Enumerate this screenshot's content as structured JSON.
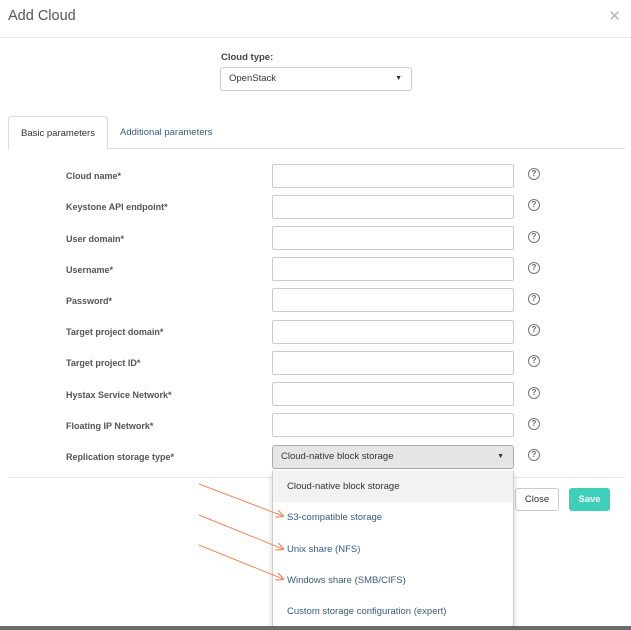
{
  "modal": {
    "title": "Add Cloud",
    "close_icon": "close-icon"
  },
  "cloud_type": {
    "label": "Cloud type:",
    "value": "OpenStack"
  },
  "tabs": [
    {
      "label": "Basic parameters",
      "active": true
    },
    {
      "label": "Additional parameters",
      "active": false
    }
  ],
  "fields": [
    {
      "label": "Cloud name*",
      "value": ""
    },
    {
      "label": "Keystone API endpoint*",
      "value": ""
    },
    {
      "label": "User domain*",
      "value": ""
    },
    {
      "label": "Username*",
      "value": ""
    },
    {
      "label": "Password*",
      "value": ""
    },
    {
      "label": "Target project domain*",
      "value": ""
    },
    {
      "label": "Target project ID*",
      "value": ""
    },
    {
      "label": "Hystax Service Network*",
      "value": ""
    },
    {
      "label": "Floating IP Network*",
      "value": ""
    }
  ],
  "replication": {
    "label": "Replication storage type*",
    "value": "Cloud-native block storage"
  },
  "dropdown_options": [
    "Cloud-native block storage",
    "S3-compatible storage",
    "Unix share (NFS)",
    "Windows share (SMB/CIFS)",
    "Custom storage configuration (expert)"
  ],
  "buttons": {
    "close": "Close",
    "save": "Save"
  },
  "help_glyph": "?",
  "colors": {
    "accent": "#3ecfb8",
    "annotation_arrow": "#f08a5d",
    "link": "#3a5a7a"
  }
}
